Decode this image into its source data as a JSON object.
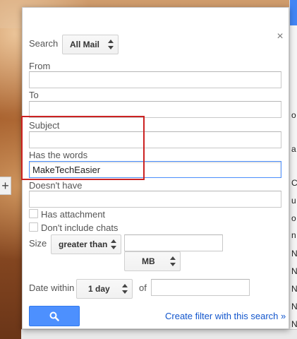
{
  "search": {
    "label": "Search",
    "scope": "All Mail"
  },
  "from": {
    "label": "From",
    "value": ""
  },
  "to": {
    "label": "To",
    "value": ""
  },
  "subject": {
    "label": "Subject",
    "value": ""
  },
  "has_words": {
    "label": "Has the words",
    "value": "MakeTechEasier"
  },
  "doesnt_have": {
    "label": "Doesn't have",
    "value": ""
  },
  "has_attachment": {
    "label": "Has attachment",
    "checked": false
  },
  "dont_include_chats": {
    "label": "Don't include chats",
    "checked": false
  },
  "size": {
    "label": "Size",
    "operator": "greater than",
    "value": "",
    "unit": "MB"
  },
  "date": {
    "label": "Date within",
    "range": "1 day",
    "of_label": "of",
    "value": ""
  },
  "actions": {
    "create_filter": "Create filter with this search »"
  },
  "colors": {
    "primary_blue": "#4d90fe",
    "link_blue": "#1155cc",
    "highlight_red": "#cc2222"
  },
  "background": {
    "plus": "+",
    "right_letters": [
      "o",
      "a",
      "C",
      "u",
      "o",
      "n",
      "N",
      "N",
      "N",
      "N",
      "N"
    ]
  }
}
